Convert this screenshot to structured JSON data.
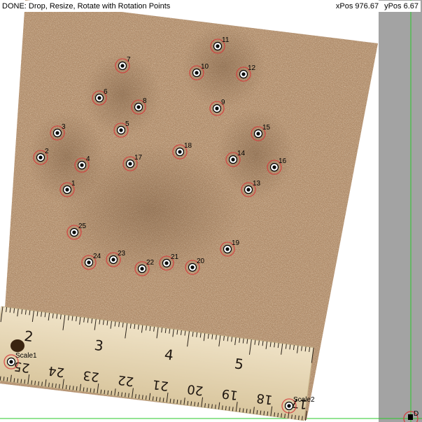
{
  "status": {
    "message": "DONE: Drop, Resize, Rotate with Rotation Points",
    "xpos": "xPos 976.67",
    "ypos": "yPos 6.67"
  },
  "corner_label": "D",
  "colors": {
    "panel_gray": "#a3a3a3",
    "guide_green": "#28c828",
    "marker_red": "#d63b3b"
  },
  "points": [
    {
      "label": "1"
    },
    {
      "label": "2"
    },
    {
      "label": "3"
    },
    {
      "label": "4"
    },
    {
      "label": "5"
    },
    {
      "label": "6"
    },
    {
      "label": "7"
    },
    {
      "label": "8"
    },
    {
      "label": "9"
    },
    {
      "label": "10"
    },
    {
      "label": "11"
    },
    {
      "label": "12"
    },
    {
      "label": "13"
    },
    {
      "label": "14"
    },
    {
      "label": "15"
    },
    {
      "label": "16"
    },
    {
      "label": "17"
    },
    {
      "label": "18"
    },
    {
      "label": "19"
    },
    {
      "label": "20"
    },
    {
      "label": "21"
    },
    {
      "label": "22"
    },
    {
      "label": "23"
    },
    {
      "label": "24"
    },
    {
      "label": "25"
    },
    {
      "label": "Scale1"
    },
    {
      "label": "Scale2"
    }
  ],
  "ruler": {
    "inch_labels": [
      "2",
      "3",
      "4",
      "5"
    ],
    "cm_labels": [
      "25",
      "24",
      "23",
      "22",
      "21",
      "20",
      "19",
      "18",
      "17"
    ]
  }
}
